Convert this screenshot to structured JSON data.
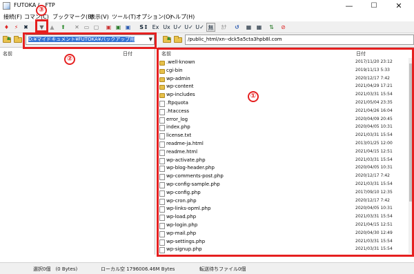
{
  "window": {
    "title": "FUTOKA (...FTP",
    "controls": {
      "minimize": "—",
      "maximize": "☐",
      "close": "✕"
    }
  },
  "menubar": {
    "items": [
      "接続(F)",
      "コマン(C)",
      "ブックマーク(B)",
      "表示(V)",
      "ツール(T)",
      "オプション(O)",
      "ヘルプ(H)"
    ]
  },
  "toolbar": {
    "buttons": [
      "S↕",
      "Ex",
      "Ux",
      "U✓",
      "U✓",
      "U✓",
      "無",
      "ｶﾅ",
      "↺",
      "▦",
      "▦",
      "⊘"
    ]
  },
  "local": {
    "path": "D:¥マイドキュメント¥FUTOKA¥バックアップ用",
    "col_name": "名前",
    "col_date": "日付"
  },
  "remote": {
    "path": "/public_html/xn--dck5a5cta3hpb8l.com",
    "col_name": "名前",
    "col_date": "日付",
    "files": [
      {
        "name": ".well-known",
        "date": "2017/11/20 23:12",
        "type": "folder"
      },
      {
        "name": "cgi-bin",
        "date": "2019/11/13  5:33",
        "type": "folder"
      },
      {
        "name": "wp-admin",
        "date": "2020/12/17  7:42",
        "type": "folder"
      },
      {
        "name": "wp-content",
        "date": "2021/04/29 17:21",
        "type": "folder"
      },
      {
        "name": "wp-includes",
        "date": "2021/03/31 15:54",
        "type": "folder"
      },
      {
        "name": ".ftpquota",
        "date": "2021/05/04 23:35",
        "type": "file"
      },
      {
        "name": ".htaccess",
        "date": "2021/04/26 16:04",
        "type": "file"
      },
      {
        "name": "error_log",
        "date": "2020/04/09 20:45",
        "type": "file"
      },
      {
        "name": "index.php",
        "date": "2020/04/05 10:31",
        "type": "file"
      },
      {
        "name": "license.txt",
        "date": "2021/03/31 15:54",
        "type": "file"
      },
      {
        "name": "readme-ja.html",
        "date": "2013/01/25 12:00",
        "type": "file"
      },
      {
        "name": "readme.html",
        "date": "2021/04/15 12:51",
        "type": "file"
      },
      {
        "name": "wp-activate.php",
        "date": "2021/03/31 15:54",
        "type": "file"
      },
      {
        "name": "wp-blog-header.php",
        "date": "2020/04/05 10:31",
        "type": "file"
      },
      {
        "name": "wp-comments-post.php",
        "date": "2020/12/17  7:42",
        "type": "file"
      },
      {
        "name": "wp-config-sample.php",
        "date": "2021/03/31 15:54",
        "type": "file"
      },
      {
        "name": "wp-config.php",
        "date": "2017/09/10 12:35",
        "type": "file"
      },
      {
        "name": "wp-cron.php",
        "date": "2020/12/17  7:42",
        "type": "file"
      },
      {
        "name": "wp-links-opml.php",
        "date": "2020/04/05 10:31",
        "type": "file"
      },
      {
        "name": "wp-load.php",
        "date": "2021/03/31 15:54",
        "type": "file"
      },
      {
        "name": "wp-login.php",
        "date": "2021/04/15 12:51",
        "type": "file"
      },
      {
        "name": "wp-mail.php",
        "date": "2020/04/30 12:49",
        "type": "file"
      },
      {
        "name": "wp-settings.php",
        "date": "2021/03/31 15:54",
        "type": "file"
      },
      {
        "name": "wp-signup.php",
        "date": "2021/03/31 15:54",
        "type": "file"
      }
    ]
  },
  "status": {
    "selection": "選択0個　(0 Bytes)",
    "local_space": "ローカル空 1796006.46M Bytes",
    "queue": "転送待ちファイル0個"
  },
  "annotations": {
    "label_1": "①",
    "label_2": "②",
    "label_3": "③",
    "color": "#e51f1f"
  }
}
